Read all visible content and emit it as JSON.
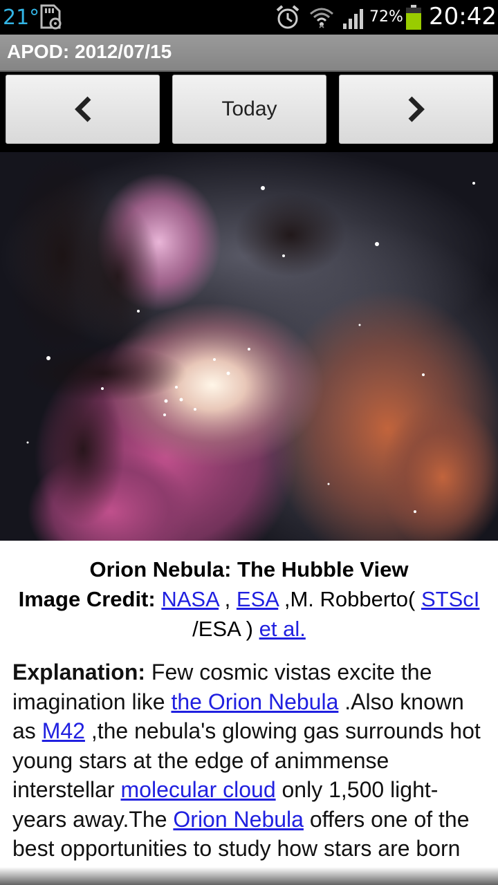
{
  "status_bar": {
    "temperature": "21°",
    "battery_percent": "72%",
    "time": "20:42",
    "icons": [
      "sd-card-settings-icon",
      "alarm-icon",
      "wifi-icon",
      "signal-icon",
      "battery-icon"
    ],
    "accent_color": "#33b5e5",
    "battery_color": "#99cc00"
  },
  "titlebar": {
    "title": "APOD: 2012/07/15"
  },
  "nav": {
    "prev_icon": "chevron-left-icon",
    "today_label": "Today",
    "next_icon": "chevron-right-icon"
  },
  "image": {
    "alt": "Orion Nebula"
  },
  "caption": {
    "title": "Orion Nebula: The Hubble View",
    "credit_label": "Image Credit:",
    "credit_nasa": "NASA",
    "sep1": " , ",
    "credit_esa": "ESA",
    "credit_mid": " ,M. Robberto(",
    "credit_stsci": "STScI",
    "credit_mid2": " /ESA ) ",
    "credit_etal": "et al."
  },
  "explanation": {
    "label": "Explanation:",
    "t1": " Few cosmic vistas excite the imagination like ",
    "link_orion": "the Orion Nebula",
    "t2": " .Also known as ",
    "link_m42": "M42",
    "t3": " ,the nebula's glowing gas surrounds hot young stars at the edge of animmense interstellar ",
    "link_cloud": "molecular cloud",
    "t4": " only 1,500 light-years away.The ",
    "link_orion2": "Orion Nebula",
    "t5": " offers one of the best opportunities to study how stars are born"
  },
  "colors": {
    "link": "#2020e0"
  }
}
